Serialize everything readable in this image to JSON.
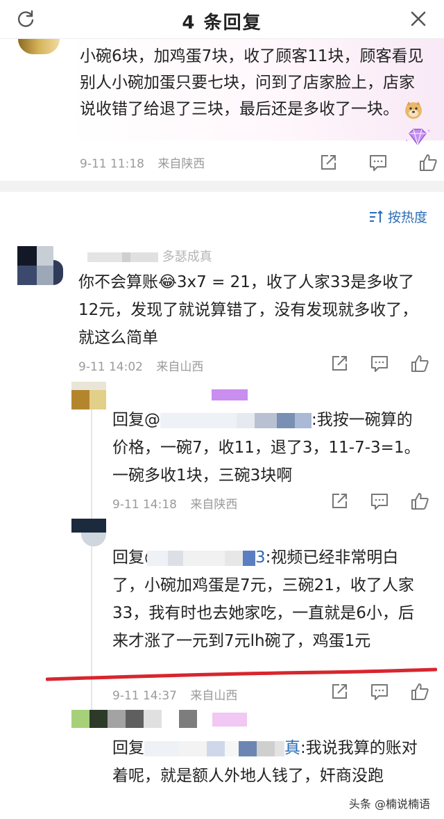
{
  "header": {
    "title": "4 条回复",
    "refresh_icon": "refresh-icon",
    "close_icon": "close-icon"
  },
  "main_comment": {
    "text": "小碗6块，加鸡蛋7块，收了顾客11块，顾客看见别人小碗加蛋只要七块，问到了店家脸上，店家说收错了给退了三块，最后还是多收了一块。",
    "time": "9-11 11:18",
    "location": "来自陕西",
    "emoji": "doge-emoji",
    "badge": "gem-badge-icon"
  },
  "sort": {
    "label": "按热度",
    "icon": "sort-icon"
  },
  "replies": [
    {
      "name_fragment": "多瑟成真",
      "text": "你不会算账😂3x7 = 21，收了人家33是多收了12元，发现了就说算错了，没有发现就多收了，就这么简单",
      "time": "9-11 14:02",
      "location": "来自山西"
    },
    {
      "prefix": "回复@",
      "text": ":我按一碗算的价格，一碗7，收11，退了3，11-7-3=1。一碗多收1块，三碗3块啊",
      "time": "9-11 14:18",
      "location": "来自陕西"
    },
    {
      "prefix": "回复@",
      "mention_tail": "3",
      "text": ":视频已经非常明白了，小碗加鸡蛋是7元，三碗21，收了人家33，我有时也去她家吃，一直就是6小，后来才涨了一元到7元lh碗了，鸡蛋1元",
      "time": "9-11 14:37",
      "location": "来自山西"
    },
    {
      "prefix": "回复",
      "mention_tail": "真",
      "text": ":我说我算的账对着呢，就是额人外地人钱了，奸商没跑"
    }
  ],
  "actions": {
    "share": "share-icon",
    "comment": "comment-icon",
    "like": "like-icon"
  },
  "watermark": "头条 @楠说楠语",
  "colors": {
    "accent": "#2a6db5",
    "red_mark": "#d7262e",
    "meta": "#9a9a9a"
  }
}
